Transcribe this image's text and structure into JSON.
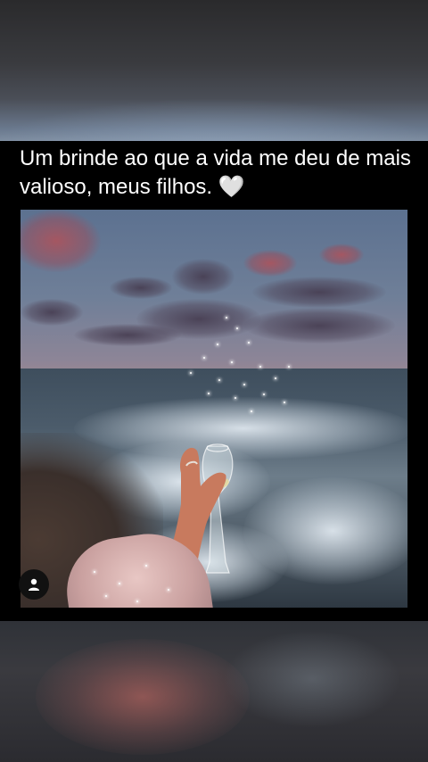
{
  "post": {
    "caption": "Um brinde ao que a vida me deu de mais valioso, meus filhos.",
    "caption_emoji": "🤍",
    "image_description_icon": "sunset-beach-toast-photo"
  },
  "overlay": {
    "profile_icon": "person-icon"
  },
  "colors": {
    "background": "#000000",
    "caption_text": "#ffffff"
  }
}
